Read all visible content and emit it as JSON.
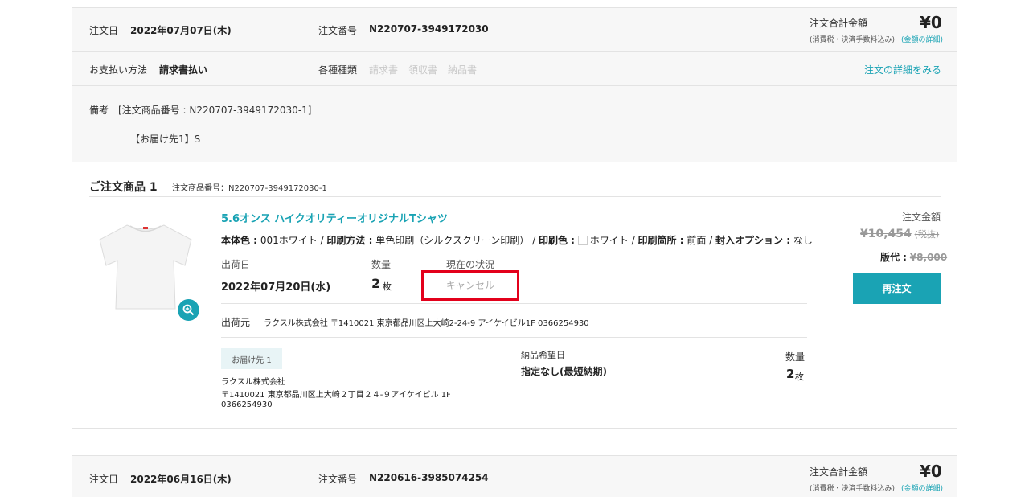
{
  "order1": {
    "order_date_label": "注文日",
    "order_date": "2022年07月07日(木)",
    "order_number_label": "注文番号",
    "order_number": "N220707-3949172030",
    "total_label": "注文合計金額",
    "total_value": "¥0",
    "total_note": "(消費税・決済手数料込み)",
    "total_detail_link": "(金額の詳細)",
    "payment_label": "お支払い方法",
    "payment_value": "請求書払い",
    "docs_label": "各種種類",
    "docs": [
      "請求書",
      "領収書",
      "納品書"
    ],
    "view_detail_link": "注文の詳細をみる",
    "note_label": "備考",
    "note_line1": "[注文商品番号 : N220707-3949172030-1]",
    "note_line2": "【お届け先1】S",
    "item": {
      "section_title": "ご注文商品 1",
      "item_number": "注文商品番号：N220707-3949172030-1",
      "product_name": "5.6オンス ハイクオリティーオリジナルTシャツ",
      "spec": {
        "body_color_label": "本体色 :",
        "body_color": "001ホワイト",
        "print_method_label": "印刷方法 :",
        "print_method": "単色印刷（シルクスクリーン印刷）",
        "print_color_label": "印刷色 :",
        "print_color": "ホワイト",
        "print_position_label": "印刷箇所 :",
        "print_position": "前面",
        "option_label": "封入オプション :",
        "option": "なし",
        "separator": "/"
      },
      "ship_date_label": "出荷日",
      "ship_date": "2022年07月20日(水)",
      "qty_label": "数量",
      "qty_value": "2",
      "qty_unit": "枚",
      "status_label": "現在の状況",
      "status_value": "キャンセル",
      "ship_from_label": "出荷元",
      "ship_from": "ラクスル株式会社 〒1410021 東京都品川区上大崎2-24-9 アイケイビル1F 0366254930",
      "price_label": "注文金額",
      "price_value": "¥10,454",
      "price_tax": "(税抜)",
      "plate_label": "版代 :",
      "plate_value": "¥8,000",
      "reorder_button": "再注文",
      "delivery": {
        "tag": "お届け先 1",
        "name": "ラクスル株式会社",
        "address": "〒1410021 東京都品川区上大崎２丁目２４-９アイケイビル 1F",
        "phone": "0366254930",
        "desired_label": "納品希望日",
        "desired_value": "指定なし(最短納期)",
        "qty_label": "数量",
        "qty_value": "2",
        "qty_unit": "枚"
      }
    }
  },
  "order2": {
    "order_date_label": "注文日",
    "order_date": "2022年06月16日(木)",
    "order_number_label": "注文番号",
    "order_number": "N220616-3985074254",
    "total_label": "注文合計金額",
    "total_value": "¥0",
    "total_note": "(消費税・決済手数料込み)",
    "total_detail_link": "(金額の詳細)"
  },
  "colors": {
    "accent": "#1aa3b4",
    "highlight": "#e3001b",
    "header_bg": "#f7f7f7"
  }
}
